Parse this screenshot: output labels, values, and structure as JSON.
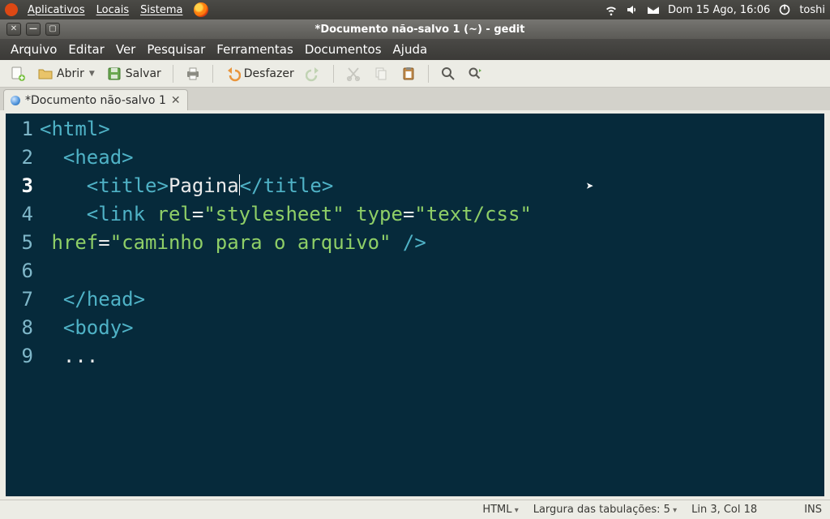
{
  "panel": {
    "menus": [
      "Aplicativos",
      "Locais",
      "Sistema"
    ],
    "clock": "Dom 15 Ago, 16:06",
    "user": "toshi"
  },
  "window": {
    "title": "*Documento não-salvo 1 (~) - gedit",
    "controls": {
      "close": "✕",
      "min": "—",
      "max": "▢"
    }
  },
  "menubar": [
    "Arquivo",
    "Editar",
    "Ver",
    "Pesquisar",
    "Ferramentas",
    "Documentos",
    "Ajuda"
  ],
  "toolbar": {
    "open": "Abrir",
    "save": "Salvar",
    "undo": "Desfazer"
  },
  "tab": {
    "label": "*Documento não-salvo 1",
    "close": "✕"
  },
  "editor": {
    "line_numbers": [
      "1",
      "2",
      "3",
      "4",
      "",
      "5",
      "6",
      "7",
      "8",
      "9"
    ],
    "current_line_index": 2,
    "code": {
      "l1": {
        "o": "<",
        "tag": "html",
        "c": ">"
      },
      "l2": {
        "indent": "  ",
        "o": "<",
        "tag": "head",
        "c": ">"
      },
      "l3": {
        "indent": "    ",
        "o": "<",
        "tag": "title",
        "c": ">",
        "text": "Pagina",
        "o2": "</",
        "tag2": "title",
        "c2": ">"
      },
      "l4a": {
        "indent": "    ",
        "o": "<",
        "tag": "link",
        "sp": " ",
        "a1": "rel",
        "eq": "=",
        "v1": "\"stylesheet\"",
        "sp2": " ",
        "a2": "type",
        "eq2": "=",
        "v2": "\"text/css\""
      },
      "l4b": {
        "wrapIndent": " ",
        "a": "href",
        "eq": "=",
        "v": "\"caminho para o arquivo\"",
        "close": " />"
      },
      "l6": {
        "indent": "  ",
        "o": "</",
        "tag": "head",
        "c": ">"
      },
      "l7": {
        "indent": "  ",
        "o": "<",
        "tag": "body",
        "c": ">"
      },
      "l8": {
        "indent": "  ",
        "text": "..."
      }
    }
  },
  "statusbar": {
    "lang": "HTML",
    "tabwidth": "Largura das tabulações: 5",
    "pos": "Lin 3, Col 18",
    "ins": "INS"
  }
}
